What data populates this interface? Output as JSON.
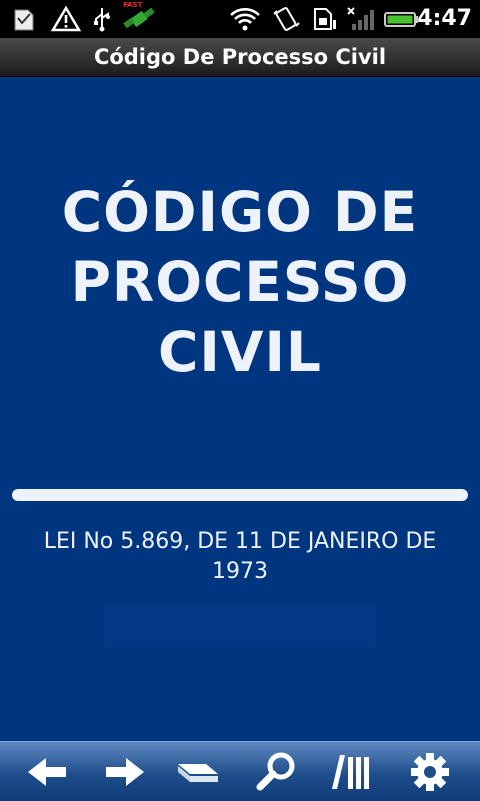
{
  "status_bar": {
    "clock": "4:47",
    "fast_label": "FAST",
    "icons": [
      "sd-card-icon",
      "warning-icon",
      "usb-icon",
      "satellite-icon",
      "wifi-icon",
      "rotate-icon",
      "sim-icon",
      "signal-icon",
      "battery-icon"
    ]
  },
  "title_bar": {
    "title": "Código De Processo Civil"
  },
  "content": {
    "heading_lines": [
      "CÓDIGO DE",
      "PROCESSO",
      "CIVIL"
    ],
    "subtitle_line1": "LEI No 5.869, DE 11 DE JANEIRO DE",
    "subtitle_line2": "1973"
  },
  "toolbar": {
    "buttons": [
      "back-arrow-icon",
      "forward-arrow-icon",
      "bookmarks-icon",
      "search-icon",
      "library-icon",
      "settings-icon"
    ]
  },
  "colors": {
    "background": "#003580",
    "text": "#eef2fa",
    "toolbar": "#1f4e8c"
  }
}
